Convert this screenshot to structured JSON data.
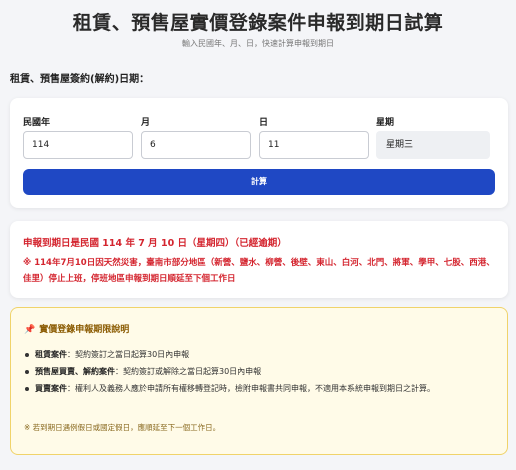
{
  "header": {
    "title": "租賃、預售屋實價登錄案件申報到期日試算",
    "subtitle": "輸入民國年、月、日，快速計算申報到期日"
  },
  "date_section_label": "租賃、預售屋簽約(解約)日期：",
  "form": {
    "year_label": "民國年",
    "year_value": "114",
    "month_label": "月",
    "month_value": "6",
    "day_label": "日",
    "day_value": "11",
    "weekday_label": "星期",
    "weekday_value": "星期三",
    "calc_button": "計算"
  },
  "result": {
    "main": "申報到期日是民國 114 年 7 月 10 日（星期四）（已經逾期）",
    "note": "※ 114年7月10日因天然災害，臺南市部分地區（新營、鹽水、柳營、後壁、東山、白河、北門、將軍、學甲、七股、西港、佳里）停止上班，停班地區申報到期日順延至下個工作日"
  },
  "info": {
    "icon": "pushpin-icon",
    "title": "實價登錄申報期限說明",
    "items": [
      {
        "term": "租賃案件",
        "text": "：契約簽訂之當日起算30日內申報"
      },
      {
        "term": "預售屋買賣、解約案件",
        "text": "：契約簽訂或解除之當日起算30日內申報"
      },
      {
        "term": "買賣案件",
        "text": "：權利人及義務人應於申請所有權移轉登記時，檢附申報書共同申報，不適用本系統申報到期日之計算。"
      }
    ],
    "footnote": "※ 若到期日遇例假日或國定假日，應順延至下一個工作日。"
  },
  "colors": {
    "accent": "#1f48c4",
    "alert": "#d4252f",
    "notice_bg": "#fffbe8",
    "notice_border": "#f0d36a"
  }
}
